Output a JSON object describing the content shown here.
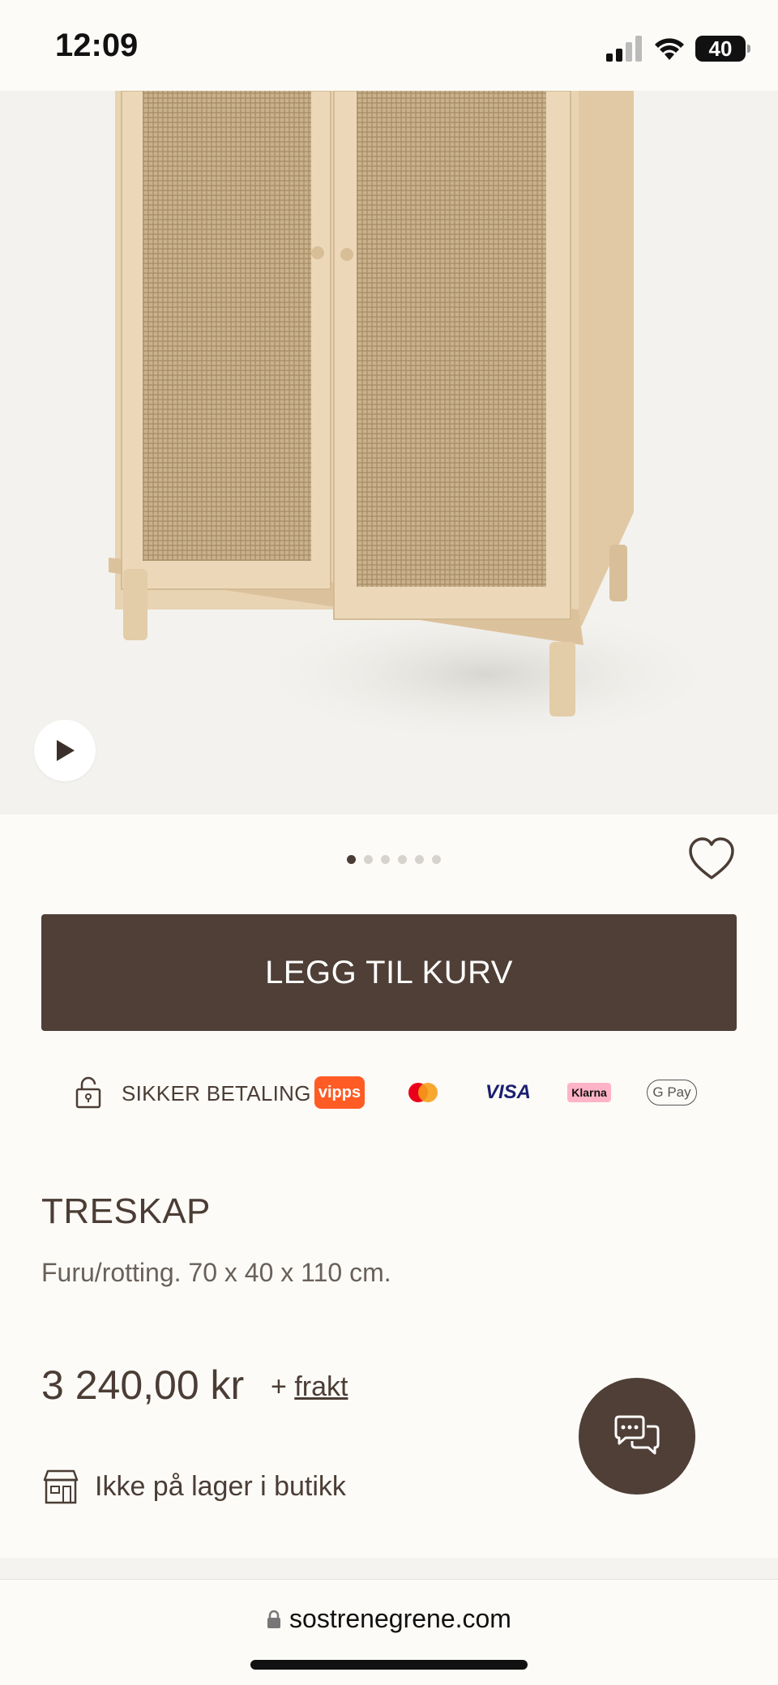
{
  "status_bar": {
    "time": "12:09",
    "battery": "40"
  },
  "carousel": {
    "count": 6,
    "active_index": 0
  },
  "cart_button_label": "LEGG TIL KURV",
  "payment": {
    "secure_label": "SIKKER BETALING",
    "methods": [
      "vipps",
      "mastercard",
      "visa",
      "klarna",
      "gpay"
    ],
    "vipps_label": "vipps",
    "visa_label": "VISA",
    "klarna_label": "Klarna",
    "gpay_label": "G Pay"
  },
  "product": {
    "title": "TRESKAP",
    "description": "Furu/rotting. 70 x 40 x 110 cm.",
    "price": "3 240,00 kr",
    "shipping_prefix": "+",
    "shipping_link": "frakt",
    "stock_status": "Ikke på lager i butikk"
  },
  "browser": {
    "url": "sostrenegrene.com"
  },
  "colors": {
    "brand_brown": "#4f3f36",
    "background": "#fcfbf7"
  }
}
